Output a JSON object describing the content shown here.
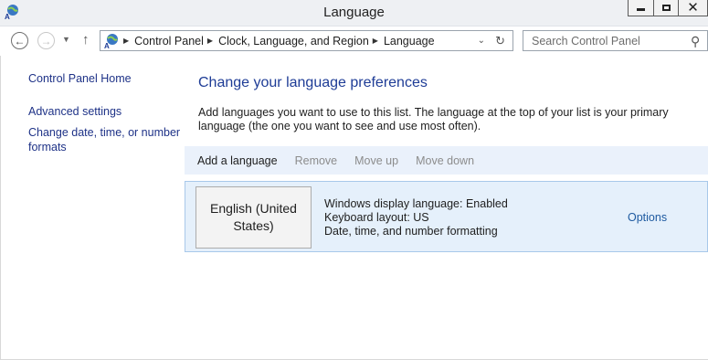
{
  "window": {
    "title": "Language",
    "app_icon": "language-globe-icon"
  },
  "nav": {
    "back_icon": "back-arrow-icon",
    "forward_icon": "forward-arrow-icon",
    "up_icon": "up-arrow-icon",
    "breadcrumbs": [
      "Control Panel",
      "Clock, Language, and Region",
      "Language"
    ],
    "search_placeholder": "Search Control Panel"
  },
  "sidebar": {
    "links": [
      "Control Panel Home",
      "Advanced settings",
      "Change date, time, or number formats"
    ]
  },
  "main": {
    "heading": "Change your language preferences",
    "intro": "Add languages you want to use to this list. The language at the top of your list is your primary language (the one you want to see and use most often).",
    "toolbar": {
      "add": "Add a language",
      "remove": "Remove",
      "move_up": "Move up",
      "move_down": "Move down"
    },
    "languages": [
      {
        "name": "English (United States)",
        "details": [
          "Windows display language: Enabled",
          "Keyboard layout: US",
          "Date, time, and number formatting"
        ],
        "options": "Options"
      }
    ]
  },
  "colors": {
    "heading": "#1e3c96",
    "link": "#1e3287",
    "toolbar_bg": "#eaf1fb",
    "row_bg": "#e5f0fb",
    "row_border": "#a8c8ea"
  }
}
